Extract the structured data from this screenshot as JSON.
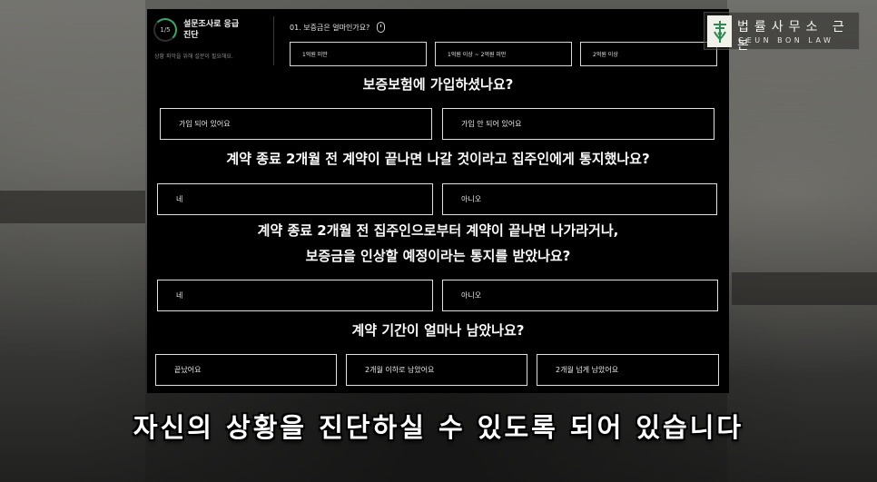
{
  "header": {
    "progress": "1/5",
    "progress_fraction": 0.2,
    "survey_title": "설문조사로 응급 진단",
    "survey_note": "상황 파악을 위해 설문이 필요해요.",
    "q1_title": "01. 보증금은 얼마인가요?",
    "q1_options": [
      "1억원 미만",
      "1억원 이상 ~ 2억원 미만",
      "2억원 이상"
    ]
  },
  "questions": [
    {
      "text": "보증보험에 가입하셨나요?",
      "options": [
        "가입 되어 있어요",
        "가입 안 되어 있어요"
      ]
    },
    {
      "text": "계약 종료 2개월 전 계약이 끝나면 나갈 것이라고 집주인에게 통지했나요?",
      "options": [
        "네",
        "아니오"
      ]
    },
    {
      "text_line1": "계약 종료 2개월 전 집주인으로부터 계약이 끝나면 나가라거나,",
      "text_line2": "보증금을 인상할 예정이라는 통지를 받았나요?",
      "options": [
        "네",
        "아니오"
      ]
    },
    {
      "text": "계약 기간이 얼마나 남았나요?",
      "options": [
        "끝났어요",
        "2개월 이하로 남았어요",
        "2개월 넘게 남았어요"
      ]
    }
  ],
  "logo": {
    "korean": "법률사무소 근본",
    "english": "GEUN BON LAW",
    "icon": "law-firm-logo-icon"
  },
  "subtitle": "자신의 상황을 진단하실 수 있도록 되어 있습니다",
  "colors": {
    "panel": "#000000",
    "accent": "#2fae6a",
    "text": "#ffffff"
  }
}
